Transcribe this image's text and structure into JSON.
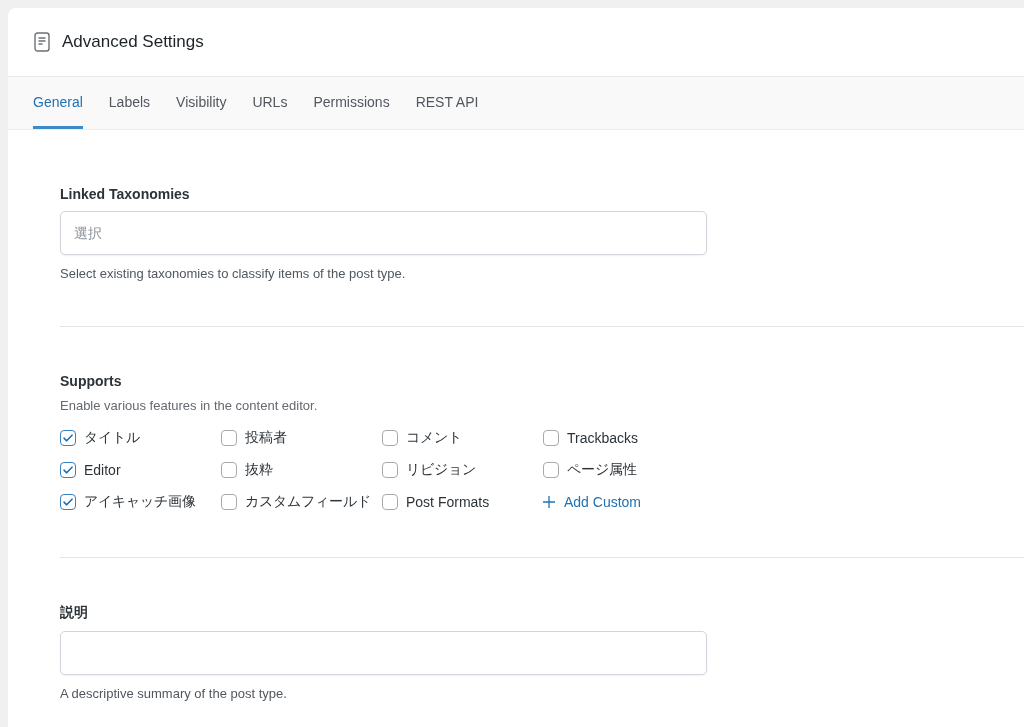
{
  "panel": {
    "title": "Advanced Settings"
  },
  "tabs": [
    {
      "label": "General",
      "selected": true
    },
    {
      "label": "Labels",
      "selected": false
    },
    {
      "label": "Visibility",
      "selected": false
    },
    {
      "label": "URLs",
      "selected": false
    },
    {
      "label": "Permissions",
      "selected": false
    },
    {
      "label": "REST API",
      "selected": false
    }
  ],
  "linked_taxonomies": {
    "label": "Linked Taxonomies",
    "placeholder": "選択",
    "help": "Select existing taxonomies to classify items of the post type."
  },
  "supports": {
    "label": "Supports",
    "description": "Enable various features in the content editor.",
    "items": [
      {
        "kind": "checkbox",
        "label": "タイトル",
        "checked": true
      },
      {
        "kind": "checkbox",
        "label": "投稿者",
        "checked": false
      },
      {
        "kind": "checkbox",
        "label": "コメント",
        "checked": false
      },
      {
        "kind": "checkbox",
        "label": "Trackbacks",
        "checked": false
      },
      {
        "kind": "checkbox",
        "label": "Editor",
        "checked": true
      },
      {
        "kind": "checkbox",
        "label": "抜粋",
        "checked": false
      },
      {
        "kind": "checkbox",
        "label": "リビジョン",
        "checked": false
      },
      {
        "kind": "checkbox",
        "label": "ページ属性",
        "checked": false
      },
      {
        "kind": "checkbox",
        "label": "アイキャッチ画像",
        "checked": true
      },
      {
        "kind": "checkbox",
        "label": "カスタムフィールド",
        "checked": false
      },
      {
        "kind": "checkbox",
        "label": "Post Formats",
        "checked": false
      },
      {
        "kind": "add",
        "label": "Add Custom"
      }
    ]
  },
  "description": {
    "label": "説明",
    "help": "A descriptive summary of the post type."
  }
}
